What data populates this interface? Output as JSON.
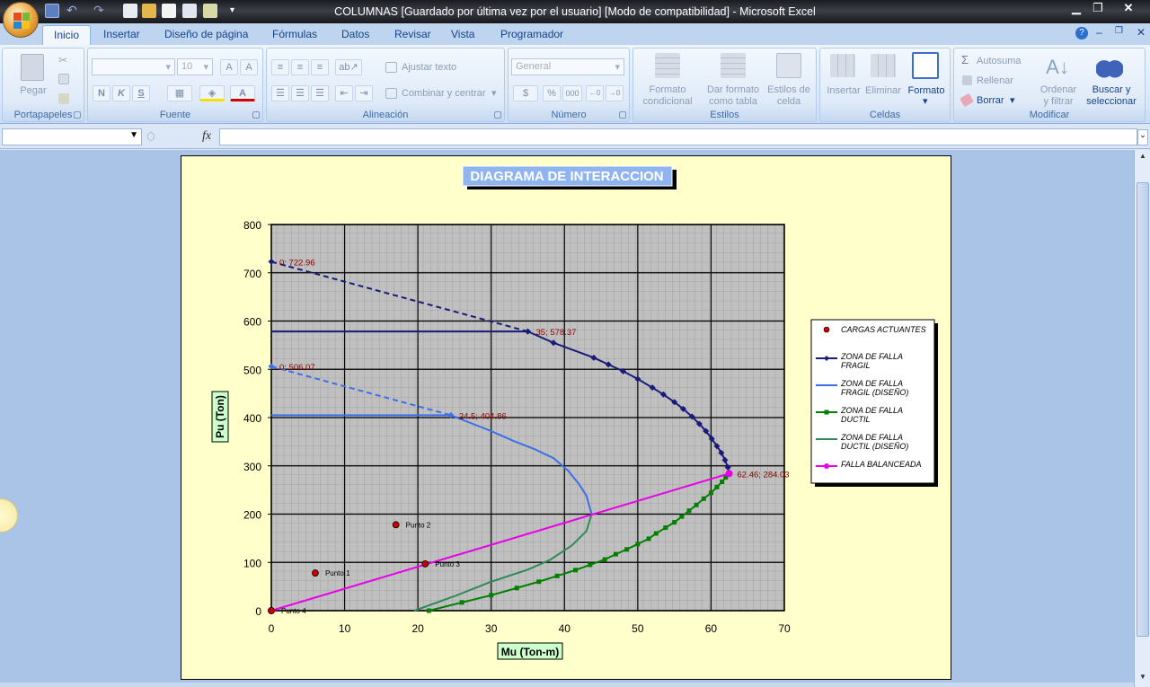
{
  "window": {
    "title": "COLUMNAS [Guardado por última vez por el usuario]  [Modo de compatibilidad] - Microsoft Excel"
  },
  "tabs": [
    "Inicio",
    "Insertar",
    "Diseño de página",
    "Fórmulas",
    "Datos",
    "Revisar",
    "Vista",
    "Programador"
  ],
  "ribbon": {
    "portapapeles": {
      "label": "Portapapeles",
      "pegar": "Pegar"
    },
    "fuente": {
      "label": "Fuente",
      "font_size": "10",
      "bold": "N",
      "italic": "K",
      "underline": "S"
    },
    "alineacion": {
      "label": "Alineación",
      "wrap": "Ajustar texto",
      "merge": "Combinar y centrar"
    },
    "numero": {
      "label": "Número",
      "format": "General",
      "currency": "$",
      "percent": "%",
      "thousands": "000"
    },
    "estilos": {
      "label": "Estilos",
      "cond_1": "Formato",
      "cond_2": "condicional",
      "table_1": "Dar formato",
      "table_2": "como tabla",
      "cell_1": "Estilos de",
      "cell_2": "celda"
    },
    "celdas": {
      "label": "Celdas",
      "insertar": "Insertar",
      "eliminar": "Eliminar",
      "formato": "Formato"
    },
    "modificar": {
      "label": "Modificar",
      "autosuma": "Autosuma",
      "rellenar": "Rellenar",
      "borrar": "Borrar",
      "sort_1": "Ordenar",
      "sort_2": "y filtrar",
      "find_1": "Buscar y",
      "find_2": "seleccionar"
    }
  },
  "formula_bar": {
    "fx": "fx",
    "name_box": "",
    "content": ""
  },
  "colors": {
    "zona_fragil": "#1a1a7a",
    "zona_fragil_diseno": "#3d6fe8",
    "zona_ductil": "#008000",
    "zona_ductil_diseno": "#2e8b57",
    "falla_balanceada": "#e800e8",
    "cargas": "#cc0000",
    "plot_bg": "#c0c0c0",
    "chart_bg": "#ffffcc"
  },
  "chart_data": {
    "type": "line",
    "title": "DIAGRAMA DE INTERACCION",
    "xlabel": "Mu (Ton-m)",
    "ylabel": "Pu (Ton)",
    "xlim": [
      0,
      70
    ],
    "ylim": [
      0,
      800
    ],
    "xticks": [
      "0",
      "10",
      "20",
      "30",
      "40",
      "50",
      "60",
      "70"
    ],
    "yticks": [
      "0",
      "100",
      "200",
      "300",
      "400",
      "500",
      "600",
      "700",
      "800"
    ],
    "grid": true,
    "legend_position": "right",
    "series": [
      {
        "name": "CARGAS ACTUANTES",
        "style": "markers",
        "points": [
          [
            6,
            78
          ],
          [
            17,
            178
          ],
          [
            21,
            97
          ],
          [
            0,
            0
          ]
        ],
        "point_labels": [
          "Punto 1",
          "Punto 2",
          "Punto 3",
          "Punto 4"
        ]
      },
      {
        "name": "ZONA  DE FALLA FRAGIL",
        "style": "line-markers",
        "points": [
          [
            0,
            722.96
          ],
          [
            35,
            578.37
          ],
          [
            38.5,
            555
          ],
          [
            44,
            524
          ],
          [
            46,
            510
          ],
          [
            48,
            496
          ],
          [
            50,
            480
          ],
          [
            52,
            462
          ],
          [
            53.5,
            448
          ],
          [
            55,
            432
          ],
          [
            56.2,
            418
          ],
          [
            57.4,
            402
          ],
          [
            58.4,
            387
          ],
          [
            59.3,
            372
          ],
          [
            60.1,
            356
          ],
          [
            60.8,
            341
          ],
          [
            61.4,
            327
          ],
          [
            61.9,
            312
          ],
          [
            62.3,
            297
          ],
          [
            62.46,
            284.03
          ]
        ]
      },
      {
        "name": "ZONA DE FALLA FRAGIL (DISEÑO)",
        "style": "line",
        "points": [
          [
            0,
            506.07
          ],
          [
            24.5,
            404.86
          ],
          [
            27,
            390
          ],
          [
            30,
            372
          ],
          [
            33,
            352
          ],
          [
            36,
            334
          ],
          [
            38.5,
            316
          ],
          [
            40.5,
            290
          ],
          [
            42,
            262
          ],
          [
            43,
            238
          ],
          [
            43.7,
            200
          ]
        ]
      },
      {
        "name": "ZONA DE FALLA DUCTIL",
        "style": "line-markers",
        "points": [
          [
            21.5,
            0
          ],
          [
            26,
            17
          ],
          [
            30,
            32
          ],
          [
            33.5,
            47
          ],
          [
            36.5,
            60
          ],
          [
            39,
            72
          ],
          [
            41.5,
            84
          ],
          [
            43.5,
            95
          ],
          [
            45.5,
            106
          ],
          [
            47,
            117
          ],
          [
            48.5,
            127
          ],
          [
            50,
            138
          ],
          [
            51.5,
            149
          ],
          [
            52.5,
            160
          ],
          [
            53.8,
            172
          ],
          [
            55,
            183
          ],
          [
            56,
            195
          ],
          [
            57,
            207
          ],
          [
            58,
            219
          ],
          [
            59,
            232
          ],
          [
            60,
            244
          ],
          [
            60.8,
            256
          ],
          [
            61.5,
            267
          ],
          [
            62,
            276
          ],
          [
            62.46,
            284.03
          ]
        ]
      },
      {
        "name": "ZONA DE FALLA DUCTIL (DISEÑO)",
        "style": "line",
        "points": [
          [
            19.5,
            0
          ],
          [
            25,
            30
          ],
          [
            30,
            60
          ],
          [
            35,
            85
          ],
          [
            38,
            105
          ],
          [
            41,
            135
          ],
          [
            43,
            165
          ],
          [
            43.7,
            200
          ]
        ]
      },
      {
        "name": "FALLA BALANCEADA",
        "style": "line-markers",
        "points": [
          [
            0,
            0
          ],
          [
            62.46,
            284.03
          ]
        ]
      }
    ],
    "reference_lines": [
      {
        "series": "ZONA  DE FALLA FRAGIL",
        "from": [
          0,
          578.37
        ],
        "to": [
          35,
          578.37
        ]
      },
      {
        "series": "ZONA DE FALLA FRAGIL (DISEÑO)",
        "from": [
          0,
          404.86
        ],
        "to": [
          24.5,
          404.86
        ]
      }
    ],
    "annotations": [
      {
        "text": "0; 722.96",
        "x": 0,
        "y": 722.96
      },
      {
        "text": "35; 578.37",
        "x": 35,
        "y": 578.37
      },
      {
        "text": "0; 506.07",
        "x": 0,
        "y": 506.07
      },
      {
        "text": "24.5; 404.86",
        "x": 24.5,
        "y": 404.86
      },
      {
        "text": "62.46; 284.03",
        "x": 62.46,
        "y": 284.03
      }
    ]
  }
}
